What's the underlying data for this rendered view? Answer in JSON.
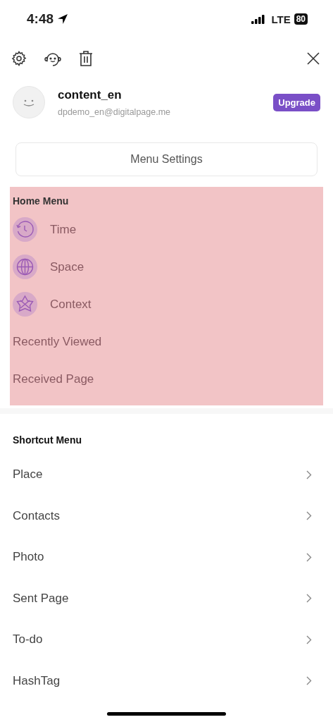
{
  "status_bar": {
    "time": "4:48",
    "network": "LTE",
    "battery": "80"
  },
  "profile": {
    "name": "content_en",
    "email": "dpdemo_en@digitalpage.me",
    "upgrade_label": "Upgrade"
  },
  "menu_settings_label": "Menu Settings",
  "home_menu": {
    "title": "Home Menu",
    "highlighted": true,
    "items": [
      {
        "label": "Time",
        "kind": "icon"
      },
      {
        "label": "Space",
        "kind": "icon"
      },
      {
        "label": "Context",
        "kind": "icon"
      },
      {
        "label": "Recently Viewed",
        "kind": "plain"
      },
      {
        "label": "Received Page",
        "kind": "plain"
      }
    ]
  },
  "shortcut_menu": {
    "title": "Shortcut Menu",
    "items": [
      "Place",
      "Contacts",
      "Photo",
      "Sent Page",
      "To-do",
      "HashTag"
    ]
  }
}
